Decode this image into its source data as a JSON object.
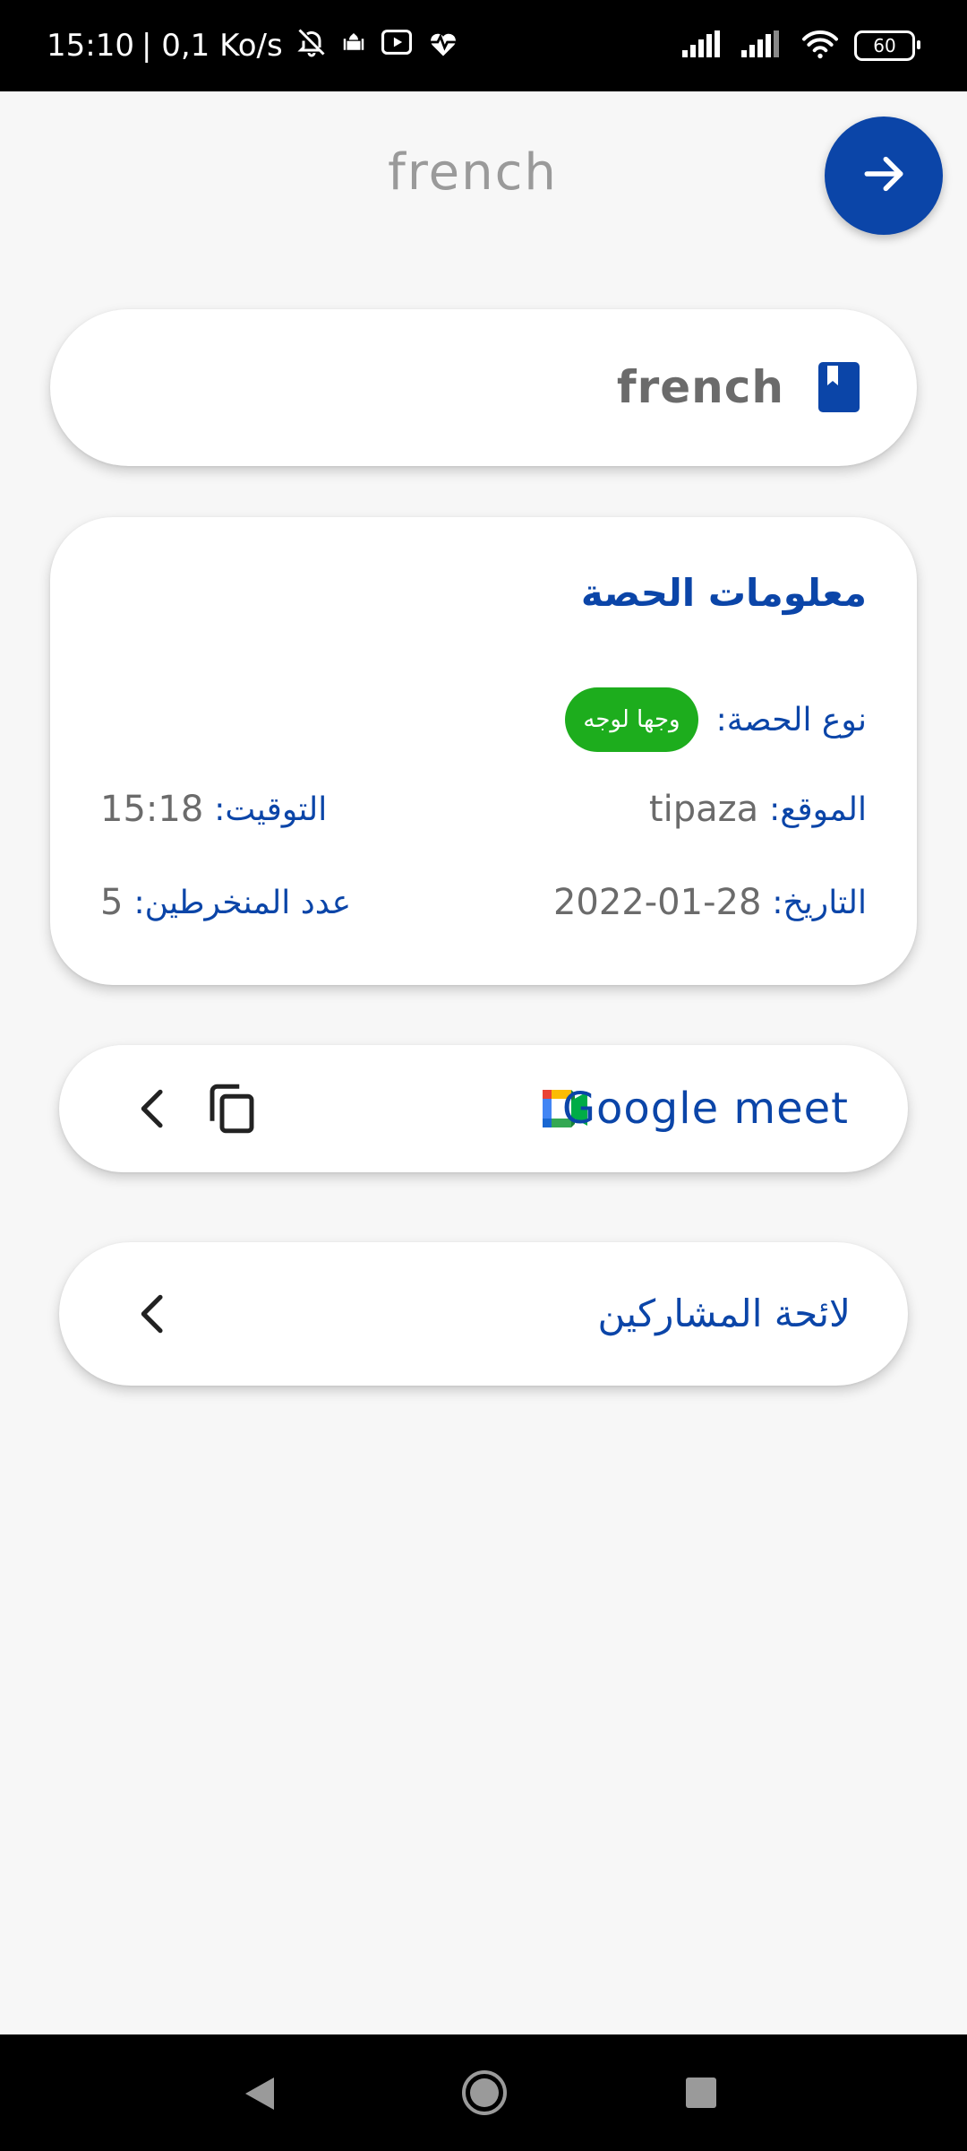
{
  "status_bar": {
    "time": "15:10",
    "speed": "| 0,1 Ko/s",
    "battery": "60",
    "icons": [
      "bell-off-icon",
      "mosque-icon",
      "youtube-icon",
      "heart-rate-icon",
      "signal-icon",
      "signal-icon",
      "wifi-icon",
      "battery-icon"
    ]
  },
  "header": {
    "title": "french",
    "next_icon": "arrow-right-icon"
  },
  "subject": {
    "name": "french",
    "icon": "bookmark-book-icon"
  },
  "session_info": {
    "title": "معلومات الحصة",
    "type_label": "نوع الحصة:",
    "type_value": "وجها لوجه",
    "location_label": "الموقع:",
    "location_value": "tipaza",
    "time_label": "التوقيت:",
    "time_value": "15:18",
    "date_label": "التاريخ:",
    "date_value": "2022-01-28",
    "enrolled_label": "عدد المنخرطين:",
    "enrolled_value": "5"
  },
  "meet": {
    "label": "Google meet",
    "logo": "google-meet-icon",
    "copy_icon": "copy-icon",
    "back_icon": "chevron-left-icon"
  },
  "participants": {
    "label": "لائحة المشاركين",
    "back_icon": "chevron-left-icon"
  },
  "colors": {
    "primary": "#0b45a8",
    "badge": "#1dad1d",
    "background": "#f7f7f7",
    "text_gray": "#6b6b6b"
  },
  "nav_bar": {
    "icons": [
      "nav-back-icon",
      "nav-home-icon",
      "nav-recent-icon"
    ]
  }
}
